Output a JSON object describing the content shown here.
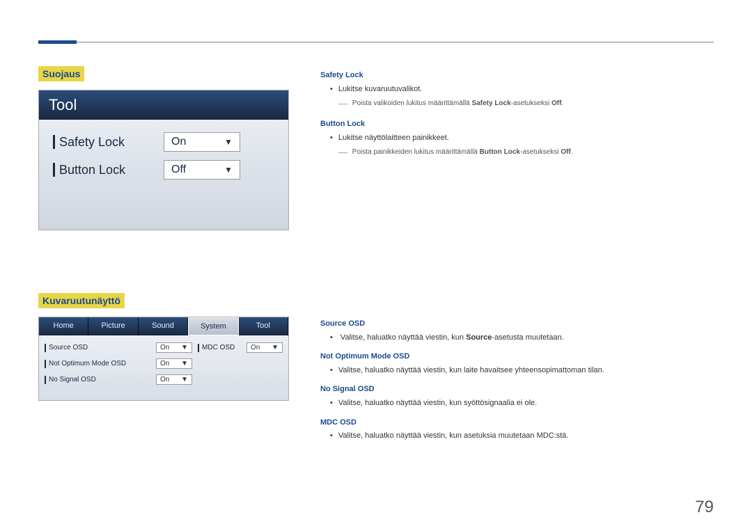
{
  "page_number": "79",
  "section1": {
    "title": "Suojaus",
    "tool_header": "Tool",
    "rows": [
      {
        "label": "Safety Lock",
        "value": "On"
      },
      {
        "label": "Button Lock",
        "value": "Off"
      }
    ]
  },
  "section2": {
    "title": "Kuvaruutunäyttö",
    "tabs": [
      "Home",
      "Picture",
      "Sound",
      "System",
      "Tool"
    ],
    "active_tab_index": 3,
    "left_rows": [
      {
        "label": "Source OSD",
        "value": "On"
      },
      {
        "label": "Not Optimum Mode OSD",
        "value": "On"
      },
      {
        "label": "No Signal OSD",
        "value": "On"
      }
    ],
    "right_rows": [
      {
        "label": "MDC OSD",
        "value": "On"
      }
    ]
  },
  "desc1": {
    "safety_lock_title": "Safety Lock",
    "safety_lock_bullet": "Lukitse kuvaruutuvalikot.",
    "safety_lock_note_prefix": "Poista valikoiden lukitus määrittämällä ",
    "safety_lock_note_bold": "Safety Lock",
    "safety_lock_note_mid": "-asetukseksi ",
    "safety_lock_note_bold2": "Off",
    "safety_lock_note_suffix": ".",
    "button_lock_title": "Button Lock",
    "button_lock_bullet": "Lukitse näyttölaitteen painikkeet.",
    "button_lock_note_prefix": "Poista painikkeiden lukitus määrittämällä ",
    "button_lock_note_bold": "Button Lock",
    "button_lock_note_mid": "-asetukseksi ",
    "button_lock_note_bold2": "Off",
    "button_lock_note_suffix": "."
  },
  "desc2": {
    "source_title": "Source OSD",
    "source_bullet_prefix": "Valitse, haluatko näyttää viestin, kun ",
    "source_bullet_bold": "Source",
    "source_bullet_suffix": "-asetusta muutetaan.",
    "notopt_title": "Not Optimum Mode OSD",
    "notopt_bullet": "Valitse, haluatko näyttää viestin, kun laite havaitsee yhteensopimattoman tilan.",
    "nosignal_title": "No Signal OSD",
    "nosignal_bullet": "Valitse, haluatko näyttää viestin, kun syöttösignaalia ei ole.",
    "mdc_title": "MDC OSD",
    "mdc_bullet": "Valitse, haluatko näyttää viestin, kun asetuksia muutetaan MDC:stä."
  }
}
